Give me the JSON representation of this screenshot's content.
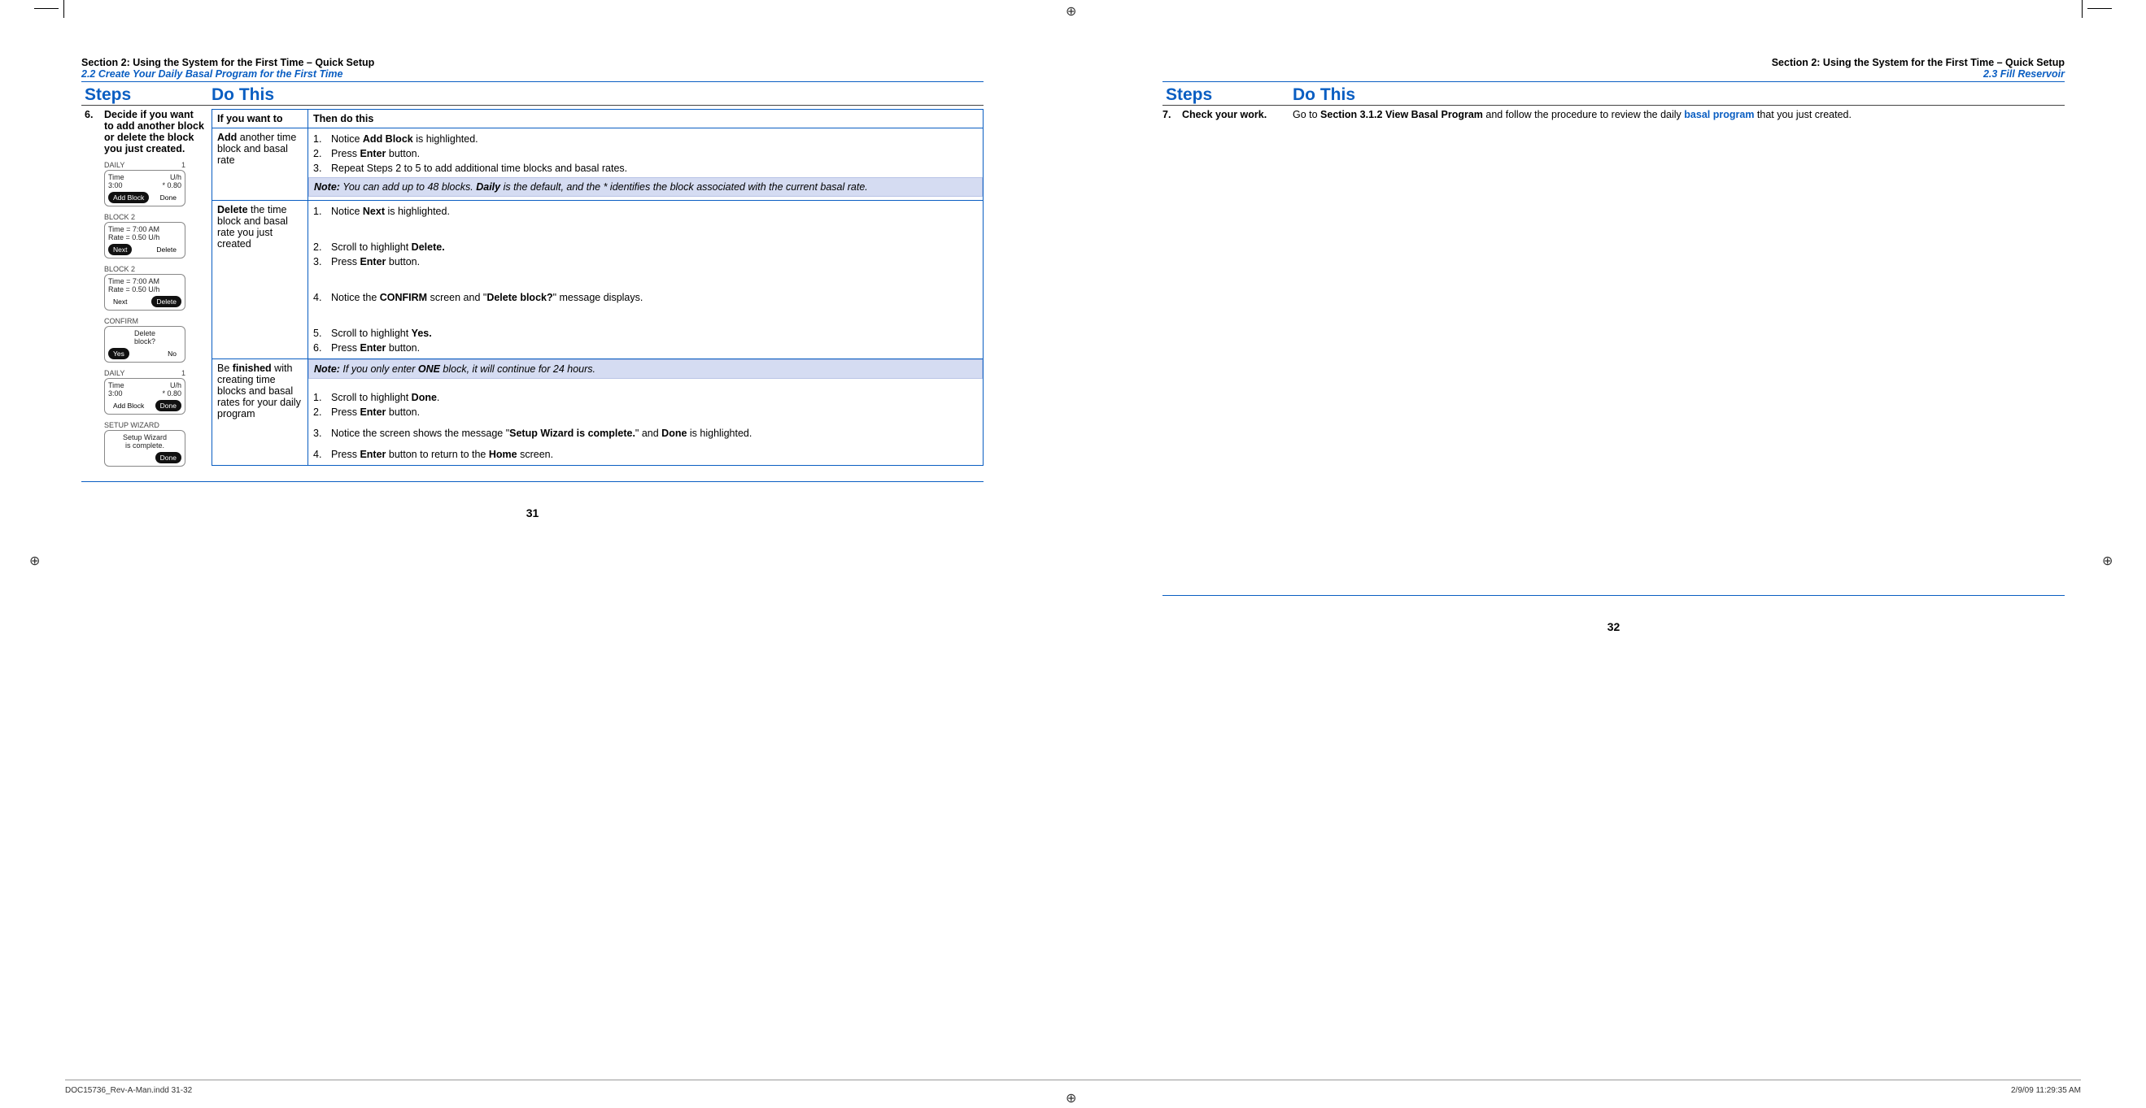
{
  "left": {
    "section_title": "Section 2: Using the System for the First Time – Quick Setup",
    "subsection": "2.2 Create Your Daily Basal Program for the First Time",
    "steps_h": "Steps",
    "do_h": "Do This",
    "step_num": "6.",
    "step_text": "Decide if you want to add another block or delete the block you just created.",
    "th_if": "If you want to",
    "th_then": "Then do this",
    "r1_if_b": "Add",
    "r1_if_rest": " another time block and basal rate",
    "r1_s1_a": "Notice ",
    "r1_s1_b": "Add Block",
    "r1_s1_c": " is highlighted.",
    "r1_s2_a": "Press ",
    "r1_s2_b": "Enter",
    "r1_s2_c": " button.",
    "r1_s3": "Repeat Steps 2 to 5 to add additional time blocks and basal rates.",
    "r1_note_nb": "Note:",
    "r1_note_a": " You can add up to 48 blocks. ",
    "r1_note_b": "Daily",
    "r1_note_c": " is the default, and the * identifies the block associated with the current basal rate.",
    "r2_if_b": "Delete",
    "r2_if_rest": " the time block and basal rate you just created",
    "r2_s1_a": "Notice ",
    "r2_s1_b": "Next",
    "r2_s1_c": " is highlighted.",
    "r2_s2_a": "Scroll to highlight ",
    "r2_s2_b": "Delete.",
    "r2_s3_a": "Press ",
    "r2_s3_b": "Enter",
    "r2_s3_c": " button.",
    "r2_s4_a": "Notice the ",
    "r2_s4_b": "CONFIRM",
    "r2_s4_c": " screen and \"",
    "r2_s4_d": "Delete block?",
    "r2_s4_e": "\" message displays.",
    "r2_s5_a": "Scroll to highlight ",
    "r2_s5_b": "Yes.",
    "r2_s6_a": "Press ",
    "r2_s6_b": "Enter",
    "r2_s6_c": " button.",
    "r3_if_a": "Be ",
    "r3_if_b": "finished",
    "r3_if_c": " with creating time blocks and basal rates for your daily program",
    "r3_note_nb": "Note:",
    "r3_note_a": " If you only enter ",
    "r3_note_b": "ONE",
    "r3_note_c": " block, it will continue for 24 hours.",
    "r3_s1_a": "Scroll to highlight ",
    "r3_s1_b": "Done",
    "r3_s1_c": ".",
    "r3_s2_a": "Press ",
    "r3_s2_b": "Enter",
    "r3_s2_c": " button.",
    "r3_s3_a": "Notice the screen shows the message \"",
    "r3_s3_b": "Setup Wizard is complete.",
    "r3_s3_c": "\" and ",
    "r3_s3_d": "Done",
    "r3_s3_e": " is highlighted.",
    "r3_s4_a": "Press ",
    "r3_s4_b": "Enter",
    "r3_s4_c": " button to return to the ",
    "r3_s4_d": "Home",
    "r3_s4_e": " screen.",
    "page_num": "31"
  },
  "right": {
    "section_title": "Section 2: Using the System for the First Time – Quick Setup",
    "subsection": "2.3 Fill Reservoir",
    "steps_h": "Steps",
    "do_h": "Do This",
    "step_num": "7.",
    "step_text": "Check your work.",
    "do_a": "Go to ",
    "do_b": "Section 3.1.2 View Basal Program",
    "do_c": " and follow the procedure to review the daily ",
    "do_d": "basal program",
    "do_e": " that you just created.",
    "page_num": "32"
  },
  "footer": {
    "left": "DOC15736_Rev-A-Man.indd   31-32",
    "right": "2/9/09   11:29:35 AM"
  },
  "dev": {
    "daily": "DAILY",
    "one": "1",
    "time": "Time",
    "uh": "U/h",
    "t300": "3:00",
    "r080": "* 0.80",
    "addblock": "Add Block",
    "done": "Done",
    "block2": "BLOCK 2",
    "time7": "Time = 7:00 AM",
    "rate05": "Rate = 0.50 U/h",
    "next": "Next",
    "delete": "Delete",
    "confirm": "CONFIRM",
    "delq1": "Delete",
    "delq2": "block?",
    "yes": "Yes",
    "no": "No",
    "sw": "SETUP WIZARD",
    "swc1": "Setup Wizard",
    "swc2": "is complete."
  }
}
